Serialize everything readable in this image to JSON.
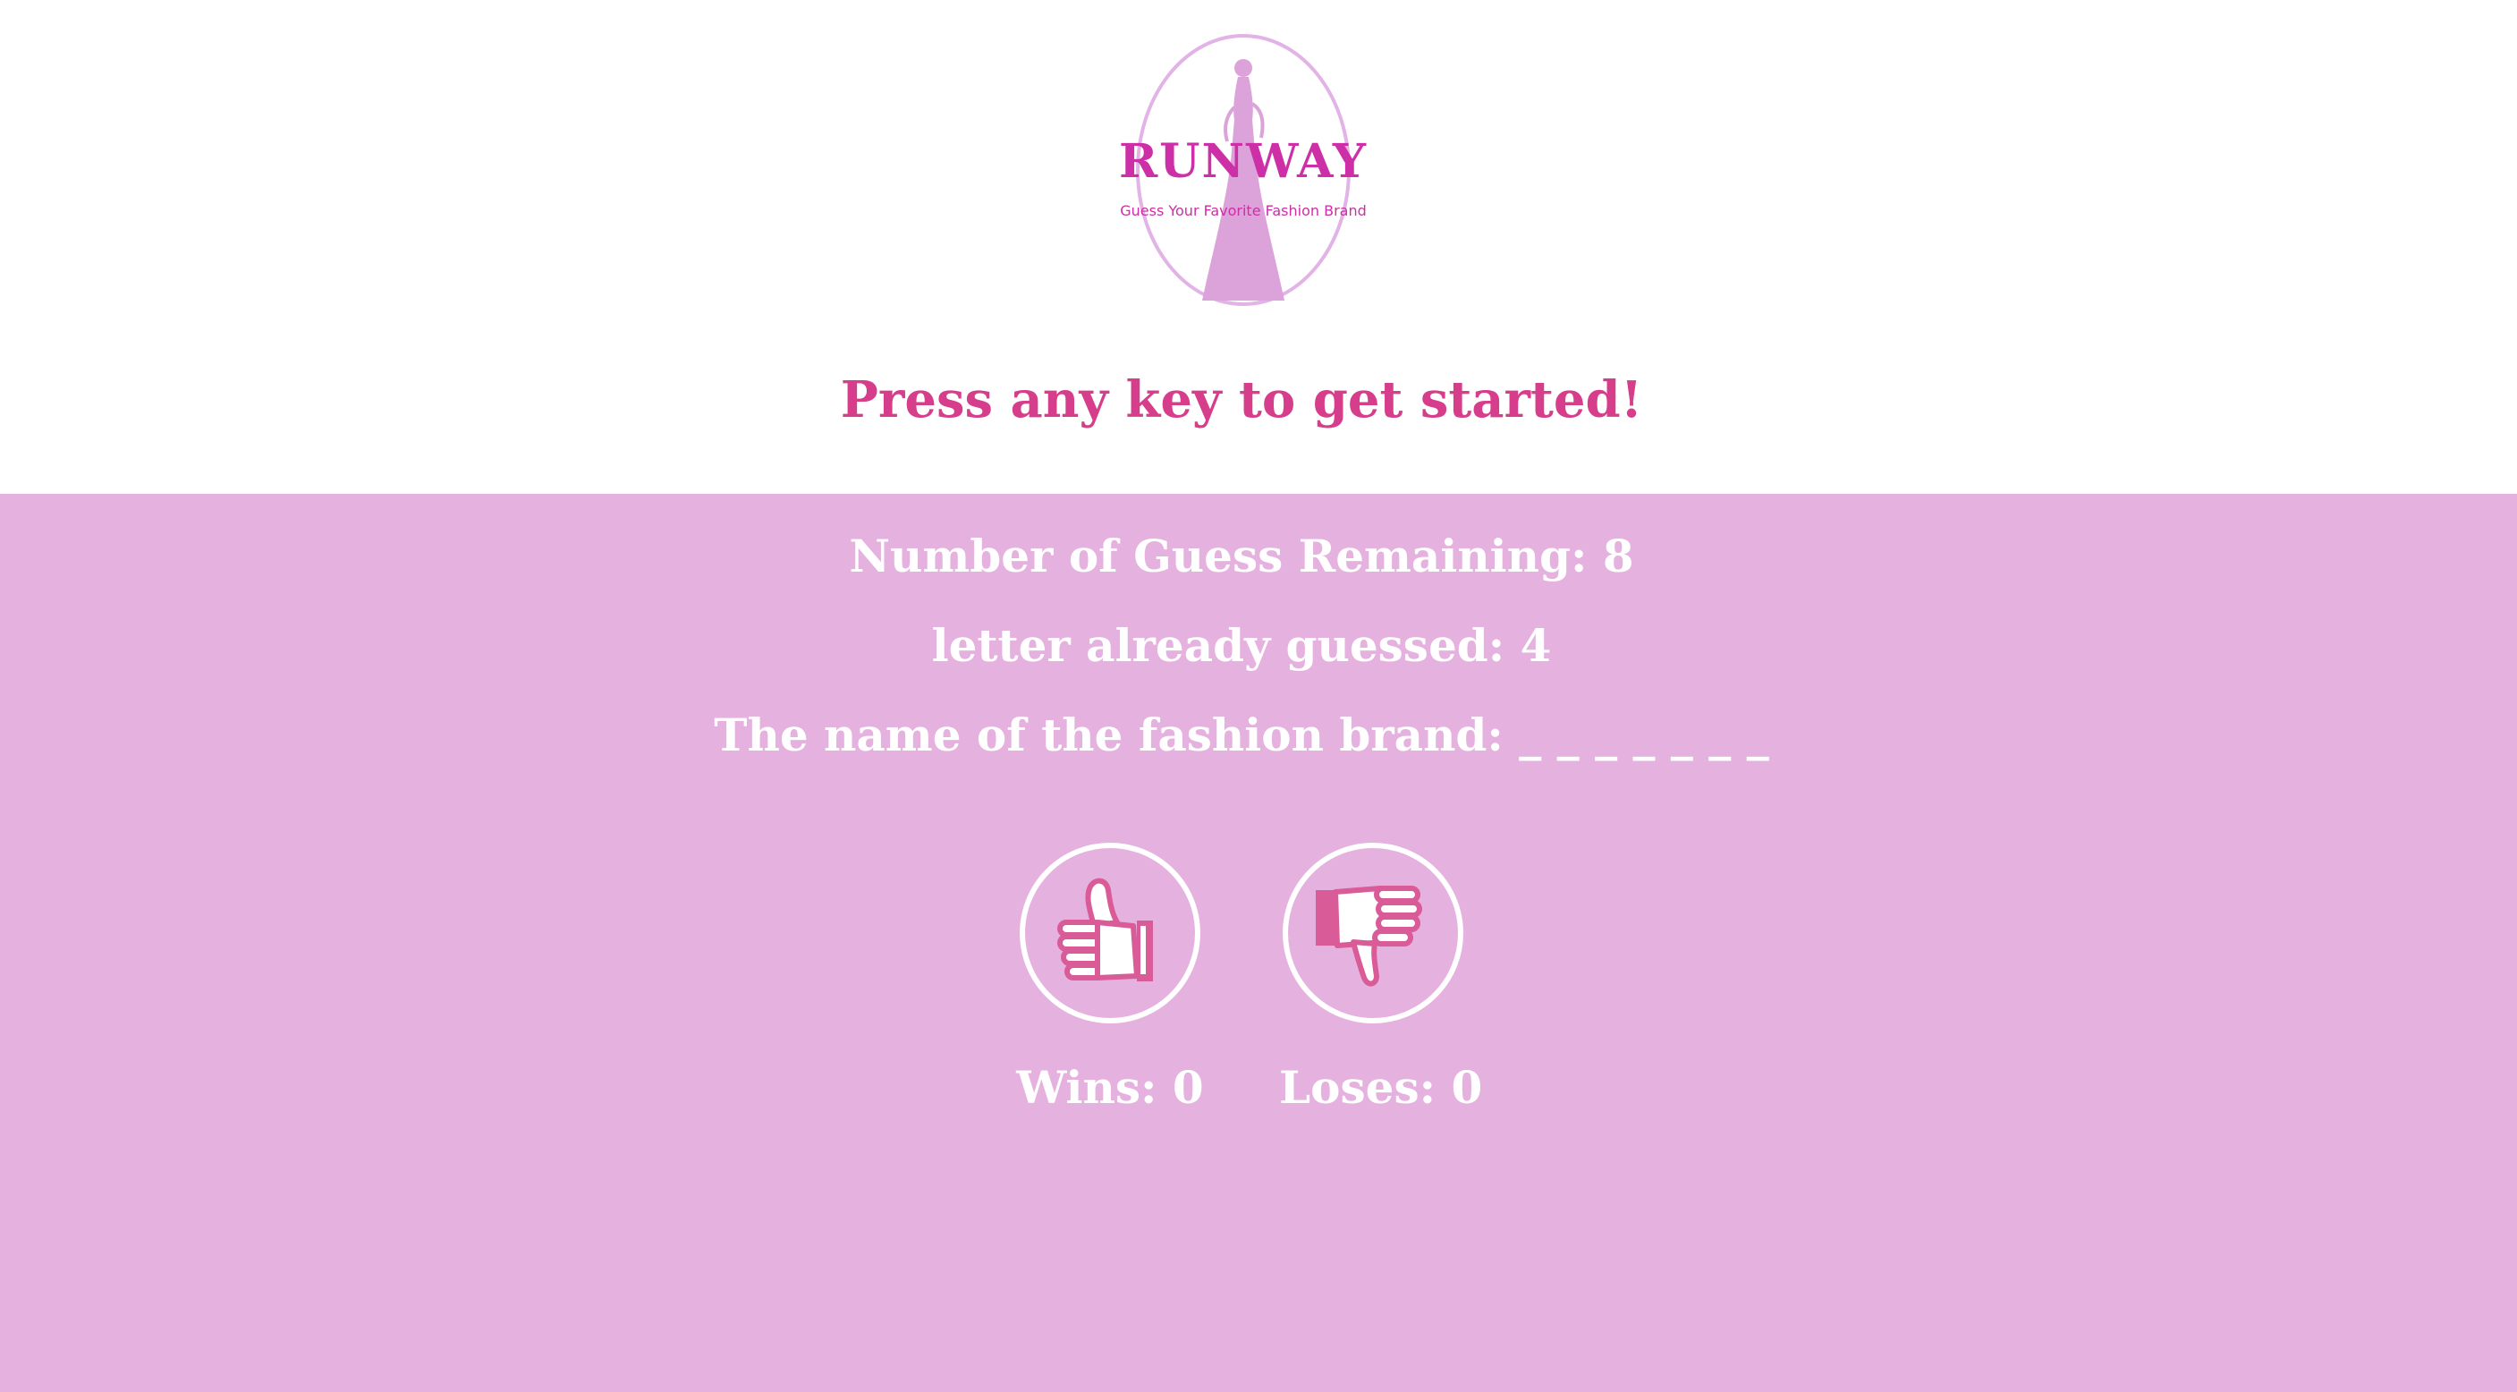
{
  "logo": {
    "title": "RUNWAY",
    "tagline": "Guess Your Favorite Fashion Brand"
  },
  "prompt": "Press any key to get started!",
  "stats": {
    "guesses_remaining": "Number of Guess Remaining: 8",
    "letters_guessed": "letter already guessed: 4",
    "brand_name": "The name of the fashion brand: _ _ _ _ _ _ _"
  },
  "score": {
    "wins_label": "Wins: 0",
    "loses_label": "Loses: 0",
    "wins_icon": "thumbs-up-icon",
    "loses_icon": "thumbs-down-icon"
  },
  "colors": {
    "stage_background": "#e5b2df",
    "prompt_text": "#d63d8a",
    "logo_accent": "#cc2fa6",
    "hand_fill": "#d95b97",
    "stat_text": "#ffffff"
  }
}
